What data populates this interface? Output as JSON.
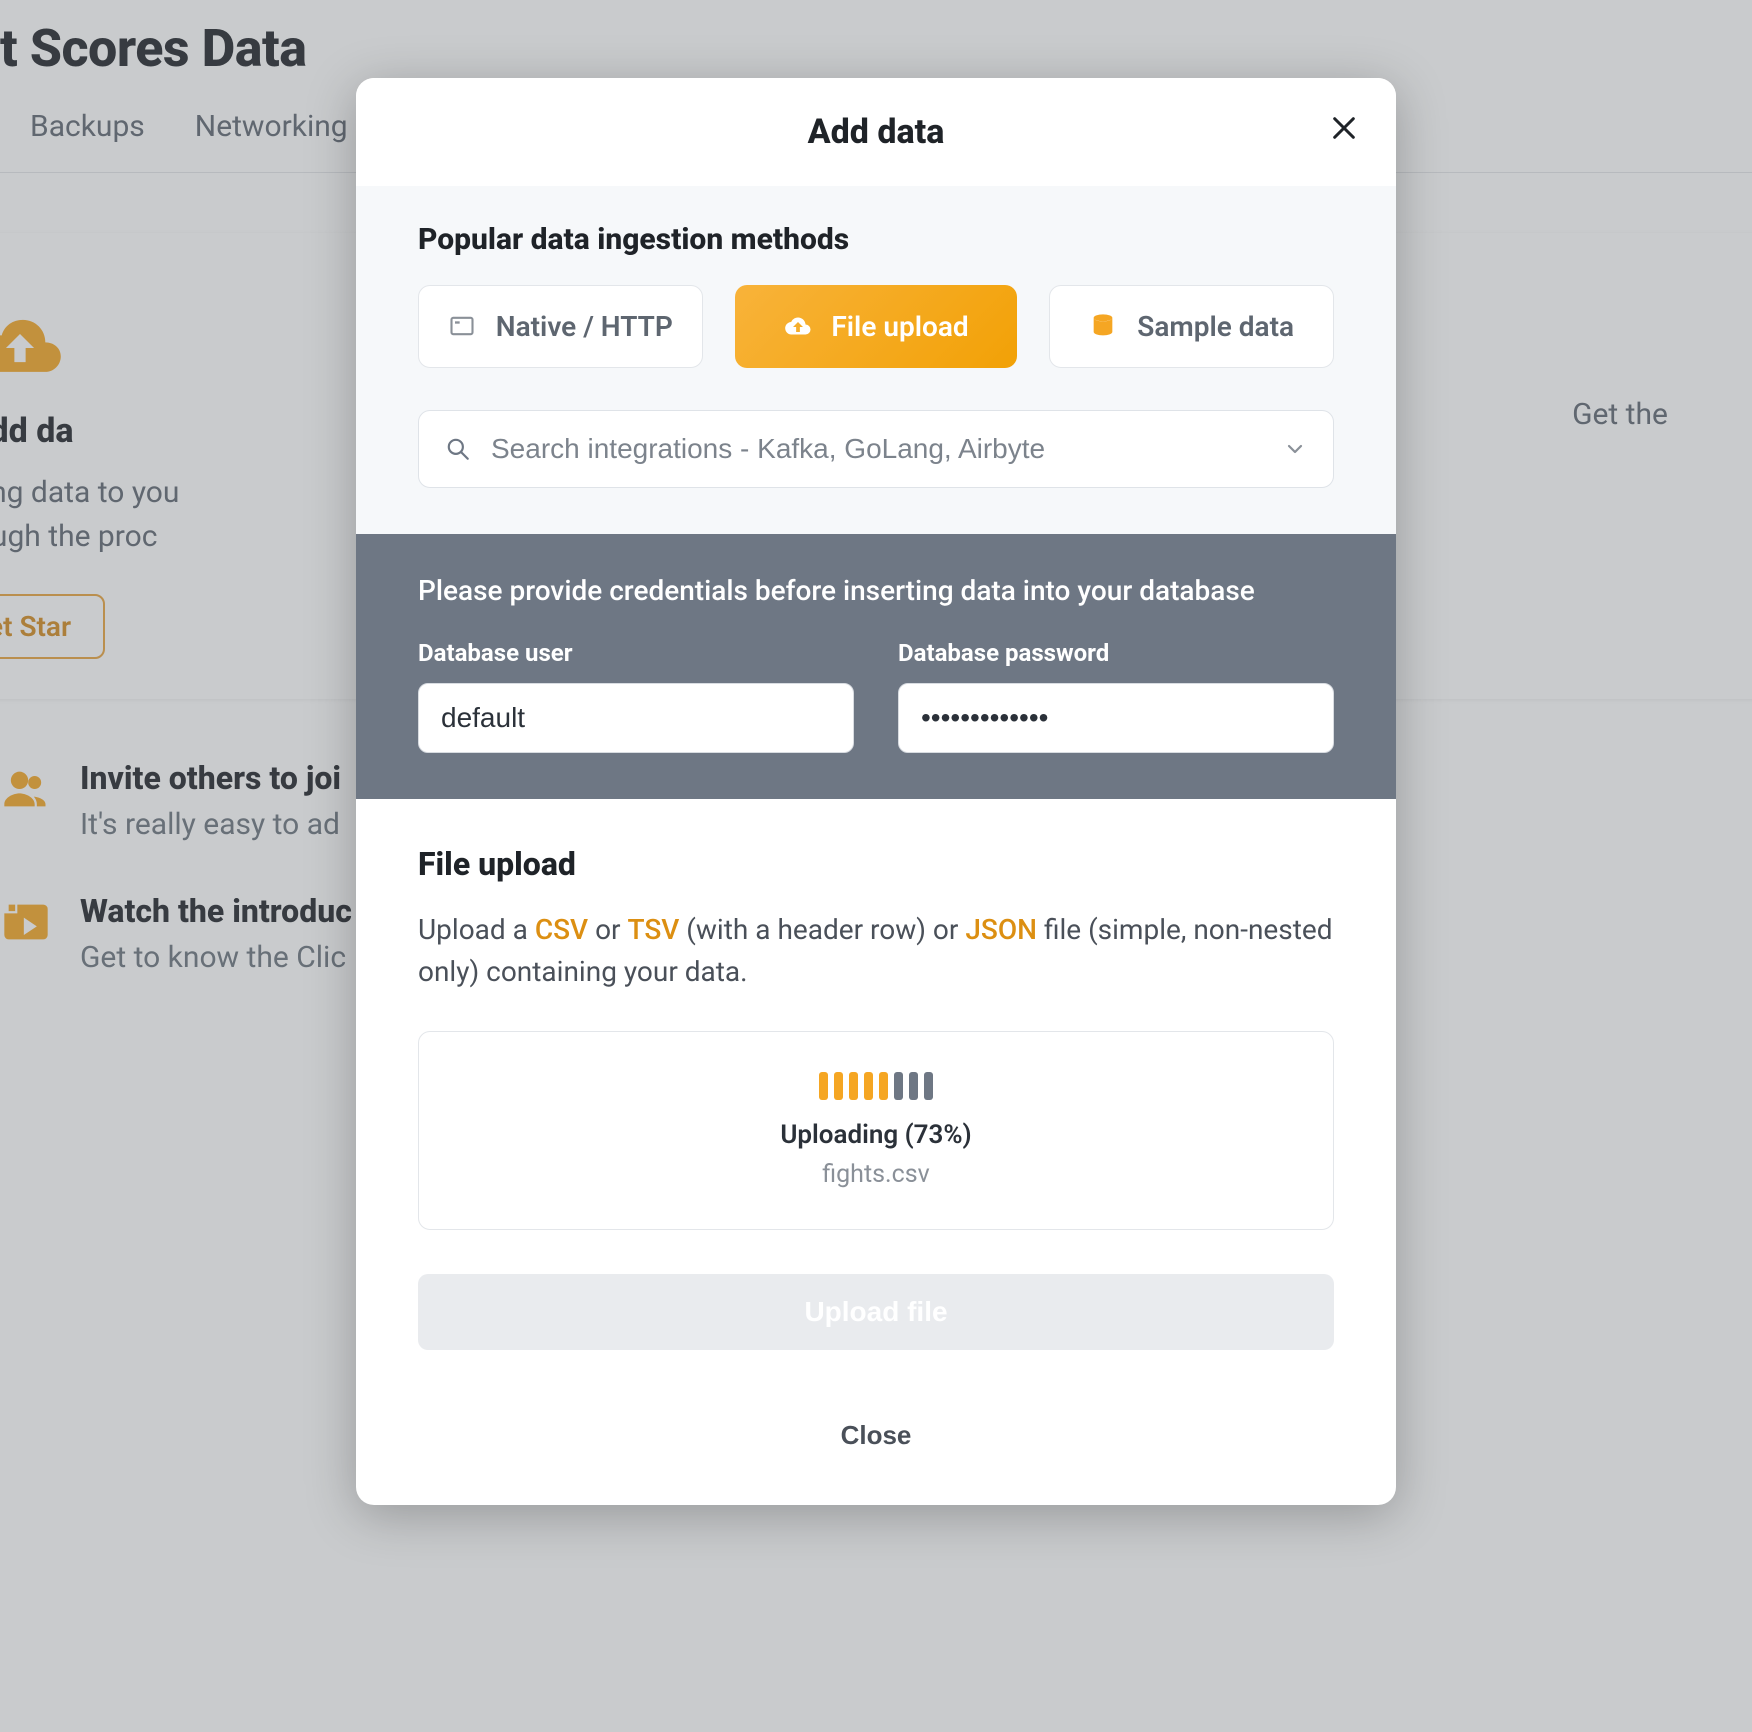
{
  "background": {
    "page_title": "t Scores Data",
    "tabs": {
      "backups": "Backups",
      "networking": "Networking"
    },
    "add_card": {
      "title": "Add da",
      "desc_line1": "Start adding data to you",
      "desc_line2": "you through the proc",
      "button": "Get Star"
    },
    "right_card": {
      "text": "Get the"
    },
    "items": {
      "invite": {
        "title": "Invite others to joi",
        "desc": "It's really easy to ad"
      },
      "video": {
        "title": "Watch the introduc",
        "desc": "Get to know the Clic"
      }
    }
  },
  "modal": {
    "title": "Add data",
    "ingest": {
      "heading": "Popular data ingestion methods",
      "methods": {
        "native": "Native / HTTP",
        "file_upload": "File upload",
        "sample": "Sample data"
      },
      "search_placeholder": "Search integrations - Kafka, GoLang, Airbyte"
    },
    "creds": {
      "title": "Please provide credentials before inserting data into your database",
      "user_label": "Database user",
      "user_value": "default",
      "pass_label": "Database password",
      "pass_value": "•••••••••••••"
    },
    "file": {
      "heading": "File upload",
      "desc_pre": "Upload a ",
      "csv": "CSV",
      "or": " or ",
      "tsv": "TSV",
      "mid": " (with a header row) or ",
      "json": "JSON",
      "end": " file (simple, non-nested only) containing your data.",
      "upload_status": "Uploading (73%)",
      "upload_filename": "fights.csv",
      "upload_button": "Upload file"
    },
    "footer": {
      "close": "Close"
    }
  }
}
